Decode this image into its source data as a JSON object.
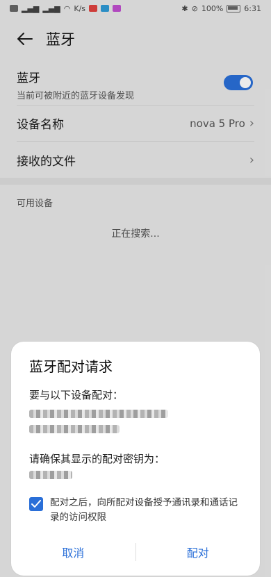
{
  "status_bar": {
    "left_text": "4G",
    "kb_speed": "K/s",
    "right_text": "100%",
    "time": "6:31"
  },
  "header": {
    "title": "蓝牙"
  },
  "bluetooth_row": {
    "title": "蓝牙",
    "subtitle": "当前可被附近的蓝牙设备发现",
    "enabled": true
  },
  "device_name_row": {
    "label": "设备名称",
    "value": "nova 5 Pro"
  },
  "received_files_row": {
    "label": "接收的文件"
  },
  "available_devices": {
    "section_title": "可用设备",
    "status": "正在搜索..."
  },
  "dialog": {
    "title": "蓝牙配对请求",
    "pair_prompt": "要与以下设备配对：",
    "confirm_prompt": "请确保其显示的配对密钥为：",
    "checkbox_text": "配对之后，向所配对设备授予通讯录和通话记录的访问权限",
    "checkbox_checked": true,
    "cancel_label": "取消",
    "pair_label": "配对"
  },
  "colors": {
    "accent": "#2A6FD8",
    "background": "#E9E9E9"
  }
}
